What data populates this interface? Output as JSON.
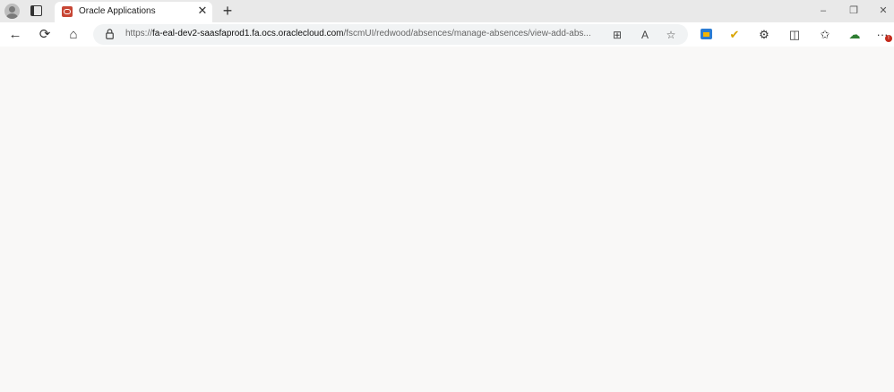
{
  "tab": {
    "title": "Oracle Applications"
  },
  "address": {
    "url_scheme": "https://",
    "url_host": "fa-eal-dev2-saasfaprod1.fa.ocs.oraclecloud.com",
    "url_path": "/fscmUI/redwood/absences/manage-absences/view-add-abs..."
  },
  "window": {
    "minimize": "–",
    "restore": "❐",
    "close": "✕"
  },
  "icons": {
    "back": "←",
    "refresh": "⟳",
    "home": "⌂",
    "split": "⊞",
    "read_aloud": "A",
    "favorite": "☆",
    "check": "✔",
    "extensions": "⚙",
    "split_screen": "◫",
    "favorites": "✩",
    "collections": "☁",
    "more": "···",
    "new_tab": "+",
    "tab_close": "✕"
  },
  "notification_badge": "!"
}
